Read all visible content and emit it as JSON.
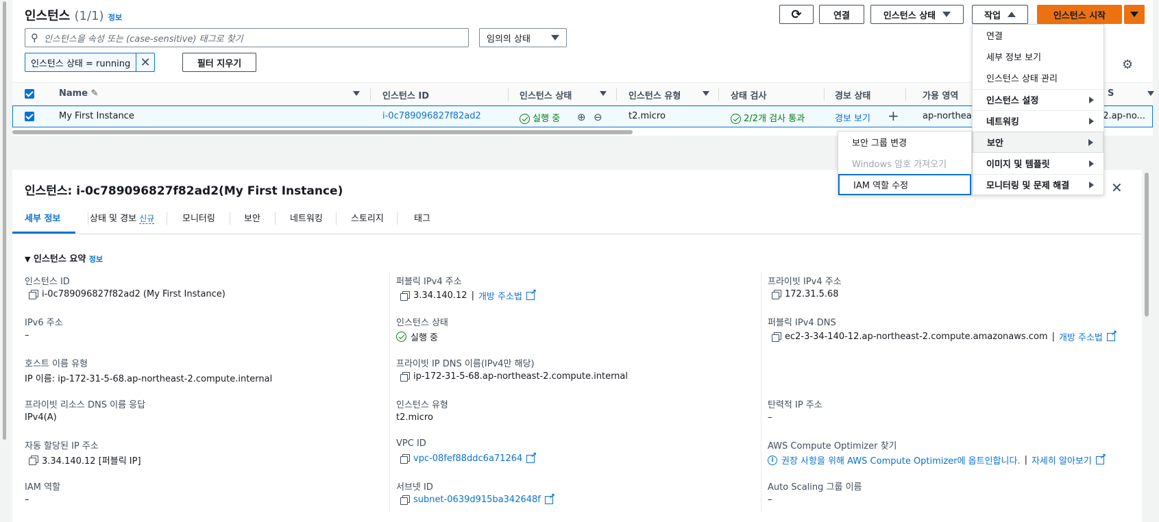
{
  "header": {
    "title": "인스턴스",
    "count": "(1/1)",
    "info": "정보",
    "connect": "연결",
    "instance_state": "인스턴스 상태",
    "actions": "작업",
    "launch": "인스턴스 시작"
  },
  "filter": {
    "search_placeholder": "인스턴스을 속성 또는 (case-sensitive) 태그로 찾기",
    "state_select": "임의의 상태",
    "token": "인스턴스 상태 = running",
    "clear": "필터 지우기"
  },
  "table": {
    "columns": [
      "Name",
      "인스턴스 ID",
      "인스턴스 상태",
      "인스턴스 유형",
      "상태 검사",
      "경보 상태",
      "가용 영역",
      "S"
    ],
    "row": {
      "name": "My First Instance",
      "id": "i-0c789096827f82ad2",
      "state": "실행 중",
      "type": "t2.micro",
      "checks": "2/2개 검사 통과",
      "alarm": "경보 보기",
      "az": "ap-northea",
      "dns": "12.ap-no..."
    }
  },
  "actions_menu": {
    "items": [
      "연결",
      "세부 정보 보기",
      "인스턴스 상태 관리",
      "인스턴스 설정",
      "네트워킹",
      "보안",
      "이미지 및 템플릿",
      "모니터링 및 문제 해결"
    ]
  },
  "security_submenu": {
    "items": [
      "보안 그룹 변경",
      "Windows 암호 가져오기",
      "IAM 역할 수정"
    ]
  },
  "detail": {
    "title": "인스턴스: i-0c789096827f82ad2(My First Instance)",
    "tabs": [
      "세부 정보",
      "상태 및 경보",
      "모니터링",
      "보안",
      "네트워킹",
      "스토리지",
      "태그"
    ],
    "new_badge": "신규",
    "section": "인스턴스 요약",
    "section_info": "정보",
    "col1": [
      {
        "label": "인스턴스 ID",
        "value": "i-0c789096827f82ad2 (My First Instance)"
      },
      {
        "label": "IPv6 주소",
        "value": "–"
      },
      {
        "label": "호스트 이름 유형",
        "value": "IP 이름: ip-172-31-5-68.ap-northeast-2.compute.internal"
      },
      {
        "label": "프라이빗 리소스 DNS 이름 응답",
        "value": "IPv4(A)"
      },
      {
        "label": "자동 할당된 IP 주소",
        "value": "3.34.140.12 [퍼블릭 IP]"
      },
      {
        "label": "IAM 역할",
        "value": "–"
      }
    ],
    "col2": [
      {
        "label": "퍼블릭 IPv4 주소",
        "value": "3.34.140.12",
        "link": "개방 주소법"
      },
      {
        "label": "인스턴스 상태",
        "value": "실행 중"
      },
      {
        "label": "프라이빗 IP DNS 이름(IPv4만 해당)",
        "value": "ip-172-31-5-68.ap-northeast-2.compute.internal"
      },
      {
        "label": "인스턴스 유형",
        "value": "t2.micro"
      },
      {
        "label": "VPC ID",
        "value": "vpc-08fef88ddc6a71264"
      },
      {
        "label": "서브넷 ID",
        "value": "subnet-0639d915ba342648f"
      }
    ],
    "col3": [
      {
        "label": "프라이빗 IPv4 주소",
        "value": "172.31.5.68"
      },
      {
        "label": "퍼블릭 IPv4 DNS",
        "value": "ec2-3-34-140-12.ap-northeast-2.compute.amazonaws.com",
        "link": "개방 주소법"
      },
      {
        "label": "탄력적 IP 주소",
        "value": "–"
      },
      {
        "label": "AWS Compute Optimizer 찾기",
        "value": "권장 사항을 위해 AWS Compute Optimizer에 옵트인합니다.",
        "link": "자세히 알아보기"
      },
      {
        "label": "Auto Scaling 그룹 이름",
        "value": "–"
      }
    ]
  }
}
